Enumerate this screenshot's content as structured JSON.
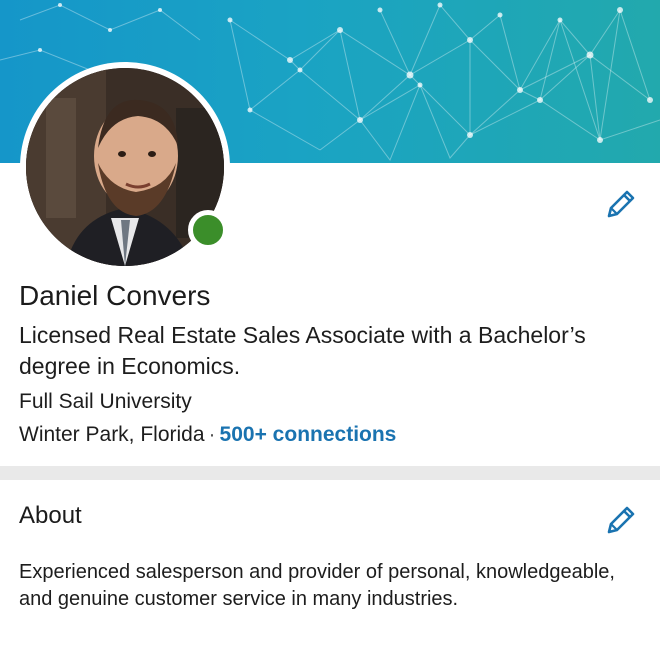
{
  "profile": {
    "name": "Daniel Convers",
    "headline": "Licensed Real Estate Sales Associate with a Bachelor’s degree in Economics.",
    "school": "Full Sail University",
    "location": "Winter Park, Florida",
    "separator": "·",
    "connections": "500+ connections",
    "online_status_color": "#3b8e2a",
    "edit_icon": "pencil-icon"
  },
  "about": {
    "title": "About",
    "body": "Experienced salesperson and provider of personal, knowledgeable, and genuine customer service in many industries.",
    "edit_icon": "pencil-icon"
  },
  "theme": {
    "link_color": "#1a73b0",
    "banner_colors": [
      "#1596c9",
      "#22a9ad"
    ]
  }
}
